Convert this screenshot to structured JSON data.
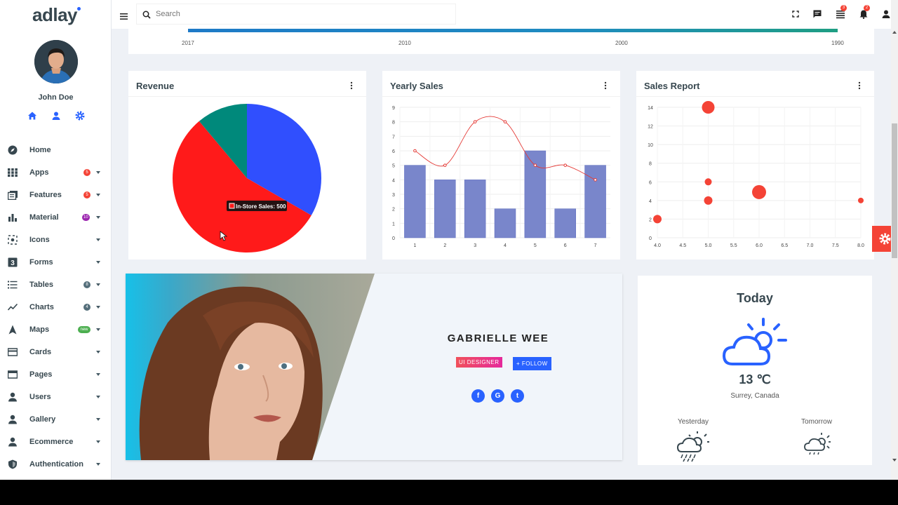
{
  "app": {
    "logo": "adlay"
  },
  "user": {
    "name": "John Doe"
  },
  "nav": [
    {
      "label": "Home",
      "icon": "compass-icon",
      "badge": null,
      "caret": false
    },
    {
      "label": "Apps",
      "icon": "apps-grid-icon",
      "badge": "5",
      "badge_color": "#f44336",
      "caret": true
    },
    {
      "label": "Features",
      "icon": "features-icon",
      "badge": "5",
      "badge_color": "#f44336",
      "caret": true
    },
    {
      "label": "Material",
      "icon": "bar-chart-icon",
      "badge": "10",
      "badge_color": "#9c27b0",
      "caret": true
    },
    {
      "label": "Icons",
      "icon": "target-icon",
      "badge": null,
      "caret": true
    },
    {
      "label": "Forms",
      "icon": "forms-icon",
      "badge": null,
      "caret": true
    },
    {
      "label": "Tables",
      "icon": "list-icon",
      "badge": "8",
      "badge_color": "#546e7a",
      "caret": true
    },
    {
      "label": "Charts",
      "icon": "line-chart-icon",
      "badge": "4",
      "badge_color": "#546e7a",
      "caret": true
    },
    {
      "label": "Maps",
      "icon": "navigation-icon",
      "badge": "new",
      "badge_color": "#4caf50",
      "caret": true
    },
    {
      "label": "Cards",
      "icon": "card-icon",
      "badge": null,
      "caret": true
    },
    {
      "label": "Pages",
      "icon": "pages-icon",
      "badge": null,
      "caret": true
    },
    {
      "label": "Users",
      "icon": "user-icon",
      "badge": null,
      "caret": true
    },
    {
      "label": "Gallery",
      "icon": "user-icon",
      "badge": null,
      "caret": true
    },
    {
      "label": "Ecommerce",
      "icon": "user-icon",
      "badge": null,
      "caret": true
    },
    {
      "label": "Authentication",
      "icon": "shield-icon",
      "badge": null,
      "caret": true
    }
  ],
  "topbar": {
    "search_placeholder": "Search",
    "notifications": {
      "list_badge": "3",
      "bell_badge": "2"
    }
  },
  "timeline": {
    "years": [
      "2017",
      "2010",
      "2000",
      "1990"
    ]
  },
  "revenue": {
    "title": "Revenue",
    "tooltip": "In-Store Sales: 500"
  },
  "yearly_sales": {
    "title": "Yearly Sales"
  },
  "sales_report": {
    "title": "Sales Report"
  },
  "chart_data": [
    {
      "type": "pie",
      "title": "Revenue",
      "slices": [
        {
          "label": "",
          "value": 300,
          "color": "#304ffe"
        },
        {
          "label": "In-Store Sales",
          "value": 500,
          "color": "#ff1a1a"
        },
        {
          "label": "",
          "value": 100,
          "color": "#00897b"
        }
      ]
    },
    {
      "type": "bar",
      "title": "Yearly Sales",
      "categories": [
        "1",
        "2",
        "3",
        "4",
        "5",
        "6",
        "7"
      ],
      "series": [
        {
          "type": "bar",
          "values": [
            5,
            4,
            4,
            2,
            6,
            2,
            5
          ],
          "color": "#7986cb"
        },
        {
          "type": "line",
          "values": [
            6,
            5,
            8,
            8,
            5,
            5,
            4
          ],
          "color": "#e53935"
        }
      ],
      "ylim": [
        0,
        9
      ],
      "yticks": [
        "0",
        "1",
        "2",
        "3",
        "4",
        "5",
        "6",
        "7",
        "8",
        "9"
      ]
    },
    {
      "type": "scatter",
      "title": "Sales Report",
      "xlim": [
        4.0,
        8.0
      ],
      "ylim": [
        0,
        14
      ],
      "xticks": [
        "4.0",
        "4.5",
        "5.0",
        "5.5",
        "6.0",
        "6.5",
        "7.0",
        "7.5",
        "8.0"
      ],
      "yticks": [
        "0",
        "2",
        "4",
        "6",
        "8",
        "10",
        "12",
        "14"
      ],
      "points": [
        {
          "x": 4.0,
          "y": 2,
          "r": 6
        },
        {
          "x": 5.0,
          "y": 14,
          "r": 9
        },
        {
          "x": 5.0,
          "y": 6,
          "r": 5
        },
        {
          "x": 5.0,
          "y": 4,
          "r": 6
        },
        {
          "x": 6.0,
          "y": 4.9,
          "r": 10
        },
        {
          "x": 8.0,
          "y": 4,
          "r": 4
        }
      ],
      "color": "#f44336"
    }
  ],
  "profile": {
    "name": "GABRIELLE WEE",
    "role_badge": "UI DESIGNER",
    "follow_label": "+ FOLLOW",
    "social": [
      "f",
      "G",
      "t"
    ]
  },
  "weather": {
    "heading": "Today",
    "temp": "13 ℃",
    "location": "Surrey, Canada",
    "yesterday_label": "Yesterday",
    "tomorrow_label": "Tomorrow"
  }
}
